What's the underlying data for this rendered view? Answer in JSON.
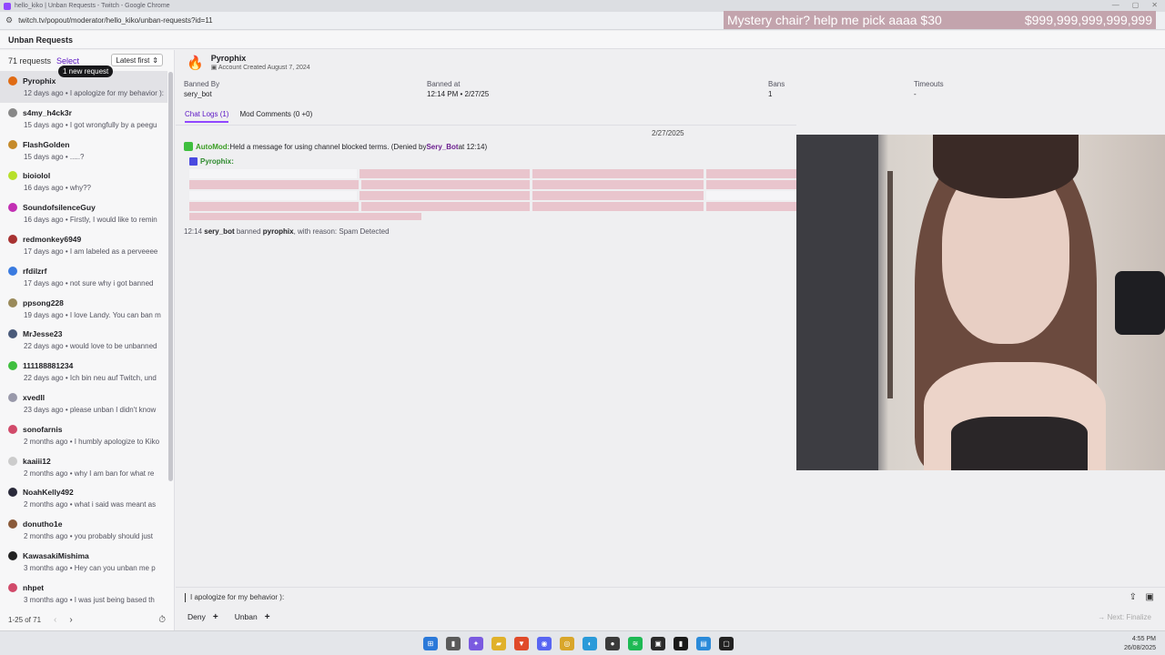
{
  "window": {
    "title": "hello_kiko | Unban Requests - Twitch - Google Chrome",
    "url": "twitch.tv/popout/moderator/hello_kiko/unban-requests?id=11"
  },
  "overlay": {
    "left": "Mystery chair? help me pick aaaa $30",
    "right": "$999,999,999,999,999"
  },
  "header": {
    "title": "Unban Requests"
  },
  "sidebar": {
    "count": "71 requests",
    "select": "Select",
    "sort": "Latest first",
    "tooltip": "1 new request",
    "items": [
      {
        "name": "Pyrophix",
        "time": "12 days ago",
        "msg": "I apologize for my behavior ):",
        "color": "#e06b14"
      },
      {
        "name": "s4my_h4ck3r",
        "time": "15 days ago",
        "msg": "I got wrongfully by a peegu",
        "color": "#888888"
      },
      {
        "name": "FlashGolden",
        "time": "15 days ago",
        "msg": ".....?",
        "color": "#c58a2a"
      },
      {
        "name": "bioiolol",
        "time": "16 days ago",
        "msg": "why??",
        "color": "#b7e02a"
      },
      {
        "name": "SoundofsilenceGuy",
        "time": "16 days ago",
        "msg": "Firstly, I would like to remin",
        "color": "#c22fb3"
      },
      {
        "name": "redmonkey6949",
        "time": "17 days ago",
        "msg": "I am labeled as a perveeee",
        "color": "#a83232"
      },
      {
        "name": "rfdilzrf",
        "time": "17 days ago",
        "msg": "not sure why i got banned",
        "color": "#3a7be0"
      },
      {
        "name": "ppsong228",
        "time": "19 days ago",
        "msg": "I love Landy. You can ban m",
        "color": "#9a8a5a"
      },
      {
        "name": "MrJesse23",
        "time": "22 days ago",
        "msg": "would love to be unbanned",
        "color": "#4a5a7a"
      },
      {
        "name": "111188881234",
        "time": "22 days ago",
        "msg": "Ich bin neu auf Twitch, und",
        "color": "#3fbf3f"
      },
      {
        "name": "xvedll",
        "time": "23 days ago",
        "msg": "please unban I didn't know",
        "color": "#9999aa"
      },
      {
        "name": "sonofarnis",
        "time": "2 months ago",
        "msg": "I humbly apologize to Kiko",
        "color": "#d14a6a"
      },
      {
        "name": "kaaiii12",
        "time": "2 months ago",
        "msg": "why I am ban for what re",
        "color": "#cccccc"
      },
      {
        "name": "NoahKelly492",
        "time": "2 months ago",
        "msg": "what i said was meant as",
        "color": "#2a2a3a"
      },
      {
        "name": "donutho1e",
        "time": "2 months ago",
        "msg": "you probably should just",
        "color": "#8a5a3a"
      },
      {
        "name": "KawasakiMishima",
        "time": "3 months ago",
        "msg": "Hey can you unban me p",
        "color": "#222222"
      },
      {
        "name": "nhpet",
        "time": "3 months ago",
        "msg": "I was just being based th",
        "color": "#d14a6a"
      }
    ],
    "footer": "1-25 of 71"
  },
  "detail": {
    "user_name": "Pyrophix",
    "created": "Account Created August 7, 2024",
    "banned_by_label": "Banned By",
    "banned_by": "sery_bot",
    "banned_at_label": "Banned at",
    "banned_at": "12:14 PM • 2/27/25",
    "bans_label": "Bans",
    "bans": "1",
    "timeouts_label": "Timeouts",
    "timeouts": "-",
    "tab_chat": "Chat Logs (1)",
    "tab_mod": "Mod Comments (0 +0)",
    "log_date": "2/27/2025",
    "automod": "AutoMod:",
    "automod_msg": " Held a message for using channel blocked terms. (Denied by ",
    "denied_by": "Sery_Bot",
    "automod_tail": " at 12:14)",
    "log_user": "Pyrophix:",
    "ban_time": "12:14",
    "ban_by": "sery_bot",
    "ban_mid": "banned",
    "ban_target": "pyrophix",
    "ban_reason": ", with reason: Spam Detected"
  },
  "reply": {
    "text": "I apologize for my behavior ):",
    "deny": "Deny",
    "unban": "Unban",
    "next": "Next: Finalize"
  },
  "taskbar": {
    "time": "4:55 PM",
    "date": "26/08/2025"
  }
}
